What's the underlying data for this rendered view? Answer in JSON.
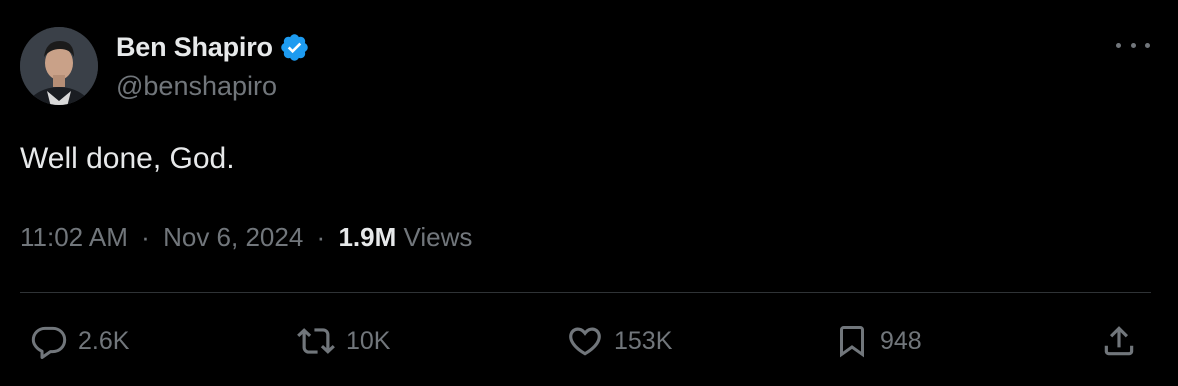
{
  "author": {
    "display_name": "Ben Shapiro",
    "handle": "@benshapiro",
    "verified": true
  },
  "tweet": {
    "text": "Well done, God.",
    "time": "11:02 AM",
    "separator": "·",
    "date": "Nov 6, 2024",
    "views_count": "1.9M",
    "views_label": "Views"
  },
  "actions": {
    "replies": "2.6K",
    "reposts": "10K",
    "likes": "153K",
    "bookmarks": "948"
  },
  "icons": {
    "reply": "reply-icon",
    "repost": "repost-icon",
    "like": "heart-icon",
    "bookmark": "bookmark-icon",
    "share": "share-icon",
    "more": "more-icon",
    "verified": "verified-badge-icon"
  },
  "colors": {
    "background": "#000000",
    "primary_text": "#e7e9ea",
    "secondary_text": "#71767b",
    "divider": "#2f3336",
    "verified_blue": "#1d9bf0"
  }
}
